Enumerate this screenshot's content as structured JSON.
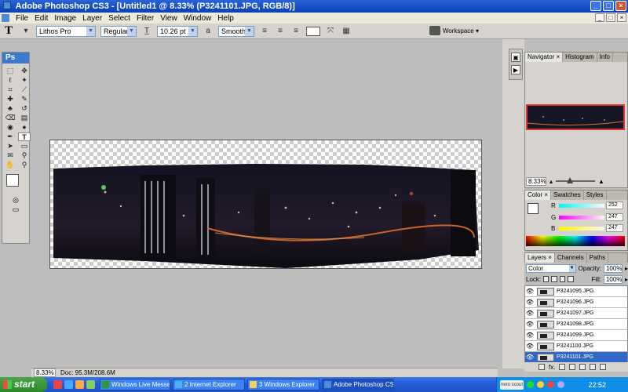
{
  "window": {
    "title": "Adobe Photoshop CS3 - [Untitled1 @ 8.33% (P3241101.JPG, RGB/8)]",
    "minimize": "_",
    "maximize": "□",
    "close": "×"
  },
  "menu": [
    "File",
    "Edit",
    "Image",
    "Layer",
    "Select",
    "Filter",
    "View",
    "Window",
    "Help"
  ],
  "doc_buttons": [
    "_",
    "□",
    "×"
  ],
  "options": {
    "tool": "T",
    "font_family": "Lithos Pro",
    "font_style": "Regular",
    "font_size": "10.26 pt",
    "aa_label": "a",
    "aa_mode": "Smooth",
    "workspace": "Workspace ▾"
  },
  "toolbox": {
    "logo": "Ps",
    "tools": [
      {
        "name": "marquee-tool",
        "glyph": "⬚"
      },
      {
        "name": "move-tool",
        "glyph": "✥"
      },
      {
        "name": "lasso-tool",
        "glyph": "ℓ"
      },
      {
        "name": "magic-wand-tool",
        "glyph": "✦"
      },
      {
        "name": "crop-tool",
        "glyph": "⌗"
      },
      {
        "name": "slice-tool",
        "glyph": "⟋"
      },
      {
        "name": "healing-brush-tool",
        "glyph": "✚"
      },
      {
        "name": "brush-tool",
        "glyph": "✎"
      },
      {
        "name": "clone-stamp-tool",
        "glyph": "♣"
      },
      {
        "name": "history-brush-tool",
        "glyph": "↺"
      },
      {
        "name": "eraser-tool",
        "glyph": "⌫"
      },
      {
        "name": "gradient-tool",
        "glyph": "▤"
      },
      {
        "name": "blur-tool",
        "glyph": "◉"
      },
      {
        "name": "dodge-tool",
        "glyph": "●"
      },
      {
        "name": "pen-tool",
        "glyph": "✒"
      },
      {
        "name": "type-tool",
        "glyph": "T"
      },
      {
        "name": "path-selection-tool",
        "glyph": "➤"
      },
      {
        "name": "shape-tool",
        "glyph": "▭"
      },
      {
        "name": "notes-tool",
        "glyph": "✉"
      },
      {
        "name": "eyedropper-tool",
        "glyph": "⚲"
      },
      {
        "name": "hand-tool",
        "glyph": "✋"
      },
      {
        "name": "zoom-tool",
        "glyph": "⚲"
      }
    ]
  },
  "status": {
    "zoom": "8.33%",
    "doc": "Doc: 95.3M/208.6M"
  },
  "navigator": {
    "tabs": [
      "Navigator ×",
      "Histogram",
      "Info"
    ],
    "zoom": "8.33%"
  },
  "color_panel": {
    "tabs": [
      "Color ×",
      "Swatches",
      "Styles"
    ],
    "channels": [
      {
        "label": "R",
        "value": "252",
        "color": "#1fd8d8"
      },
      {
        "label": "G",
        "value": "247",
        "color": "#e04ee0"
      },
      {
        "label": "B",
        "value": "247",
        "color": "#e8e814"
      }
    ]
  },
  "layers_panel": {
    "tabs": [
      "Layers ×",
      "Channels",
      "Paths"
    ],
    "blend_mode": "Color",
    "opacity_label": "Opacity:",
    "opacity": "100%",
    "lock_label": "Lock:",
    "fill_label": "Fill:",
    "fill": "100%",
    "layers": [
      {
        "name": "P3241095.JPG",
        "selected": false
      },
      {
        "name": "P3241096.JPG",
        "selected": false
      },
      {
        "name": "P3241097.JPG",
        "selected": false
      },
      {
        "name": "P3241098.JPG",
        "selected": false
      },
      {
        "name": "P3241099.JPG",
        "selected": false
      },
      {
        "name": "P3241100.JPG",
        "selected": false
      },
      {
        "name": "P3241101.JPG",
        "selected": true
      }
    ],
    "footer": "fx."
  },
  "taskbar": {
    "start": "start",
    "tasks": [
      {
        "label": "Windows Live Messen...",
        "color": "#2d9a2d"
      },
      {
        "label": "2 Internet Explorer",
        "color": "#4ab0f0"
      },
      {
        "label": "3 Windows Explorer",
        "color": "#f4d060"
      },
      {
        "label": "Adobe Photoshop CS...",
        "color": "#4d8cd6",
        "active": true
      }
    ],
    "tray_logo": "nero scout",
    "clock": "22:52"
  }
}
